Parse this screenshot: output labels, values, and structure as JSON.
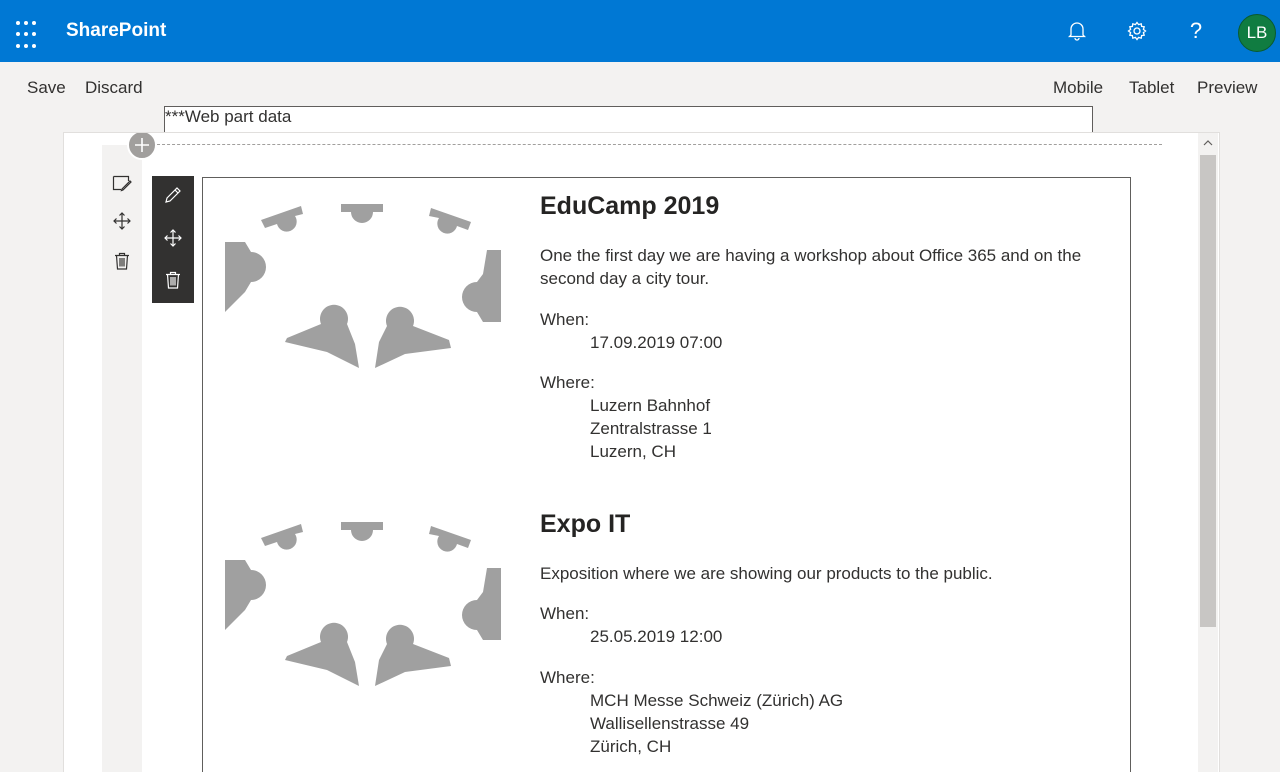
{
  "suitebar": {
    "brand": "SharePoint",
    "avatar_initials": "LB",
    "help_glyph": "?",
    "accent_color": "#0078d4",
    "icons": [
      "app-launcher-icon",
      "bell-icon",
      "gear-icon",
      "help-icon"
    ]
  },
  "commandbar": {
    "save": "Save",
    "discard": "Discard",
    "webpart_data": "***Web part data",
    "mobile": "Mobile",
    "tablet": "Tablet",
    "preview": "Preview"
  },
  "events": [
    {
      "title": "EduCamp 2019",
      "description": "One the first day we are having a workshop about Office 365 and on the second day a city tour.",
      "when_label": "When:",
      "when": "17.09.2019 07:00",
      "where_label": "Where:",
      "where_lines": [
        "Luzern Bahnhof",
        "Zentralstrasse 1",
        "Luzern, CH"
      ]
    },
    {
      "title": "Expo IT",
      "description": "Exposition where we are showing our products to the public.",
      "when_label": "When:",
      "when": "25.05.2019 12:00",
      "where_label": "Where:",
      "where_lines": [
        "MCH Messe Schweiz (Zürich) AG",
        "Wallisellenstrasse 49",
        "Zürich, CH"
      ]
    }
  ]
}
